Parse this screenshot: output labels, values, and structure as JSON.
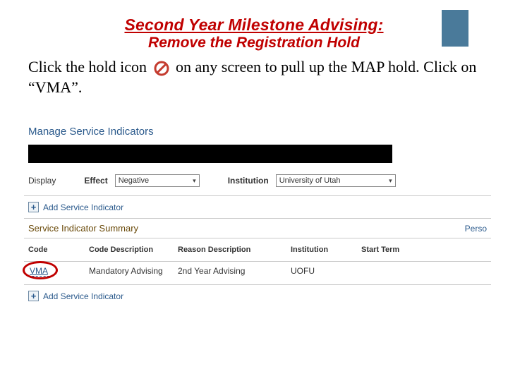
{
  "title": {
    "line1": "Second Year Milestone Advising:",
    "line2": "Remove the Registration Hold"
  },
  "instruction": {
    "part1": "Click the hold icon ",
    "part2": " on any screen to pull up the MAP hold.  Click on “VMA”."
  },
  "app": {
    "panel_title": "Manage Service Indicators",
    "display_label": "Display",
    "effect_label": "Effect",
    "effect_value": "Negative",
    "institution_label": "Institution",
    "institution_value": "University of Utah",
    "add_link": "Add Service Indicator",
    "summary_title": "Service Indicator Summary",
    "perso": "Perso",
    "columns": {
      "code": "Code",
      "code_desc": "Code Description",
      "reason_desc": "Reason Description",
      "institution": "Institution",
      "start_term": "Start Term"
    },
    "row": {
      "code": "VMA",
      "code_desc": "Mandatory Advising",
      "reason_desc": "2nd Year Advising",
      "institution": "UOFU",
      "start_term": ""
    }
  }
}
